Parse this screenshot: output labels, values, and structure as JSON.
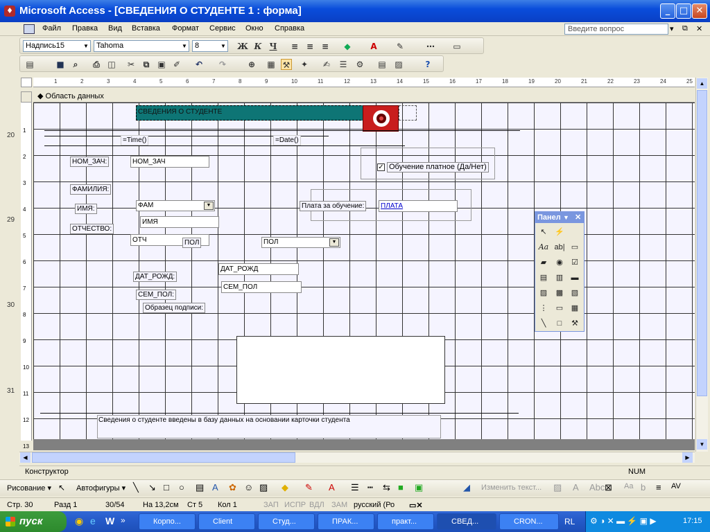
{
  "window": {
    "title": "Microsoft Access - [СВЕДЕНИЯ О СТУДЕНТЕ 1 : форма]"
  },
  "menu": {
    "items": [
      "Файл",
      "Правка",
      "Вид",
      "Вставка",
      "Формат",
      "Сервис",
      "Окно",
      "Справка"
    ],
    "ask_placeholder": "Введите вопрос"
  },
  "format_toolbar": {
    "object": "Надпись15",
    "font": "Tahoma",
    "size": "8"
  },
  "sidebar_labels": [
    "20",
    "29",
    "30",
    "31"
  ],
  "ruler": {
    "marks": [
      "1",
      "2",
      "3",
      "4",
      "5",
      "6",
      "7",
      "8",
      "9",
      "10",
      "11",
      "12",
      "13",
      "14",
      "15",
      "16",
      "17",
      "18",
      "19",
      "20",
      "21",
      "22",
      "23",
      "24",
      "25"
    ],
    "vmarks": [
      "1",
      "2",
      "3",
      "4",
      "5",
      "6",
      "7",
      "8",
      "9",
      "10",
      "11",
      "12",
      "13"
    ]
  },
  "section": {
    "label": "Область данных"
  },
  "form": {
    "header_title": "СВЕДЕНИЯ О СТУДЕНТЕ",
    "time_expr": "=Time()",
    "date_expr": "=Date()",
    "nom_zach_label": "НОМ_ЗАЧ:",
    "nom_zach_field": "НОМ_ЗАЧ",
    "paid_checkbox": "Обучение платное (Да/Нет)",
    "surname_label": "ФАМИЛИЯ:",
    "name_label": "ИМЯ:",
    "surname_combo": "ФАМ",
    "fee_label": "Плата за обучение:",
    "fee_field": "ПЛАТА",
    "name_field": "ИМЯ",
    "patronymic_label": "ОТЧЕСТВО:",
    "patronymic_field": "ОТЧ",
    "gender_label": "ПОЛ",
    "gender_combo": "ПОЛ",
    "birth_label": "ДАТ_РОЖД:",
    "birth_field": "ДАТ_РОЖД",
    "marital_label": "СЕМ_ПОЛ:",
    "marital_field": "СЕМ_ПОЛ",
    "signature_label": "Образец подписи:",
    "footer_note": "Сведения о студенте введены в базу данных на основании карточки студента"
  },
  "palette": {
    "title": "Панел"
  },
  "status": {
    "mode": "Конструктор",
    "num": "NUM"
  },
  "draw_toolbar": {
    "drawing": "Рисование",
    "autoshapes": "Автофигуры",
    "change_text": "Изменить текст..."
  },
  "word_status": {
    "page": "Стр. 30",
    "section": "Разд 1",
    "pages": "30/54",
    "at": "На 13,2см",
    "line": "Ст 5",
    "col": "Кол 1",
    "rec": "ЗАП",
    "trk": "ИСПР",
    "ext": "ВДЛ",
    "ovr": "ЗАМ",
    "lang": "русский (Ро"
  },
  "taskbar": {
    "start": "пуск",
    "tasks": [
      "Корпо...",
      "Client",
      "Студ...",
      "ПРАК...",
      "практ...",
      "СВЕД...",
      "CRON..."
    ],
    "lang": "RL",
    "clock": "17:15"
  }
}
